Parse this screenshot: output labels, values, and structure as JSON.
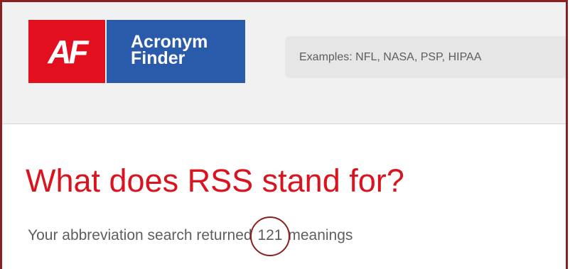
{
  "logo": {
    "mark": "AF",
    "name_line1": "Acronym",
    "name_line2": "Finder"
  },
  "search": {
    "placeholder": "Examples: NFL, NASA, PSP, HIPAA"
  },
  "result": {
    "title": "What does RSS stand for?",
    "summary_prefix": "Your abbreviation search returned",
    "count": "121",
    "summary_suffix": "meanings"
  },
  "colors": {
    "brand_red": "#e2101f",
    "brand_blue": "#2a5bab",
    "title_red": "#d9141f",
    "annotation": "#8c1f1f"
  }
}
